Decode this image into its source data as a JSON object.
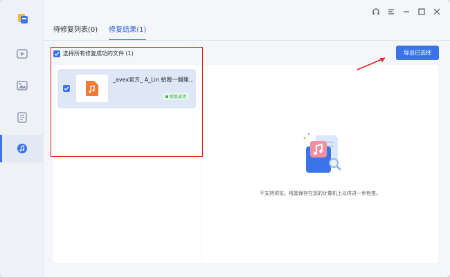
{
  "tabs": [
    {
      "label": "待修复列表(0)",
      "active": false
    },
    {
      "label": "修复结果(1)",
      "active": true
    }
  ],
  "select_all": {
    "label": "选择所有修复成功的文件 (1)",
    "checked": true
  },
  "export_button": {
    "label": "导出已选择"
  },
  "files": [
    {
      "name": "_avex官方_ A_Lin 給我一個理...",
      "status": "修复成功",
      "checked": true,
      "icon": "music-file-icon"
    }
  ],
  "preview": {
    "message": "不支持预览。将其保存在您的计算机上以供进一步检查。"
  },
  "sidebar": {
    "items": [
      "video-icon",
      "image-icon",
      "document-icon",
      "audio-icon"
    ],
    "active": "audio-icon"
  },
  "titlebar": {
    "icons": [
      "headset-icon",
      "menu-icon",
      "minimize-icon",
      "maximize-icon",
      "close-icon"
    ]
  },
  "colors": {
    "accent": "#3a74e8",
    "success": "#36a852",
    "annotation": "#e02020"
  }
}
